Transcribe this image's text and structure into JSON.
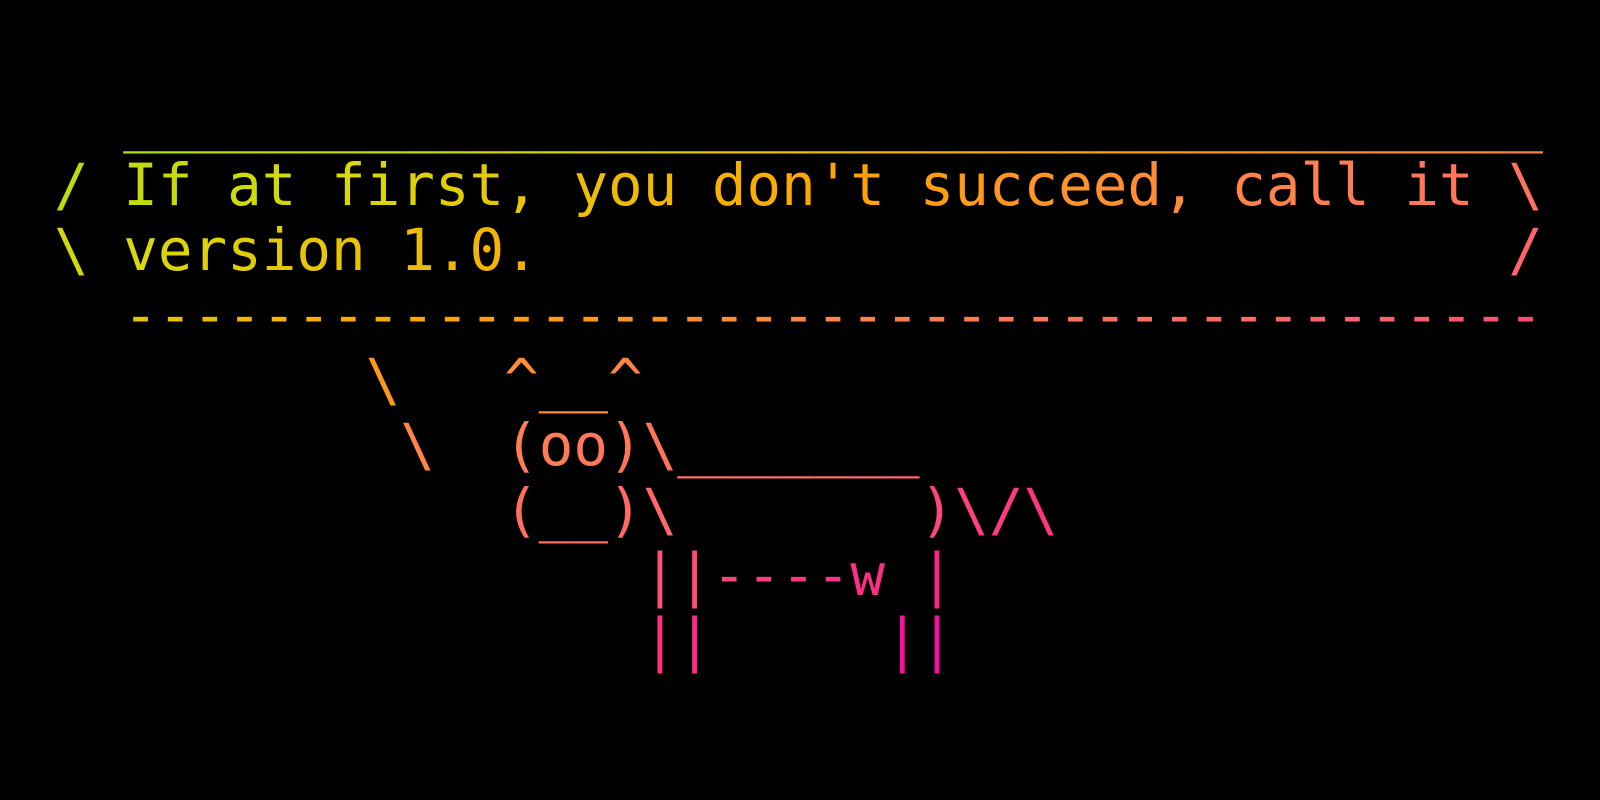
{
  "background_color": "#000000",
  "gradient_colors": [
    "#a8e00a",
    "#d8d80a",
    "#ffa500",
    "#ff7f50",
    "#ff6070",
    "#ff1493",
    "#cc00cc",
    "#8b00ff"
  ],
  "lines": [
    "  _________________________________________",
    "/ If at first, you don't succeed, call it \\",
    "\\ version 1.0.                            /",
    "  -----------------------------------------",
    "         \\   ^__^",
    "          \\  (oo)\\_______",
    "             (__)\\       )\\/\\",
    "                 ||----w |",
    "                 ||     ||"
  ]
}
